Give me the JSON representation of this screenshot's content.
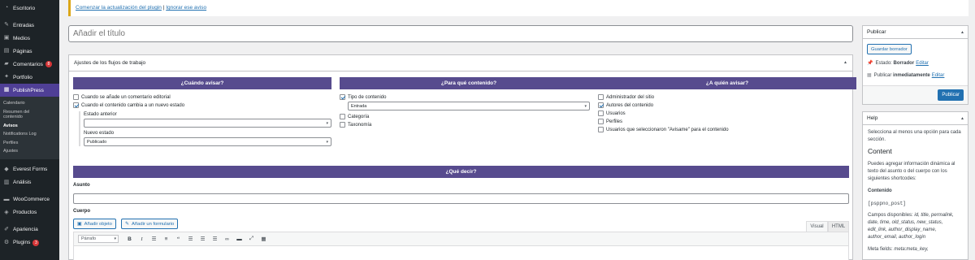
{
  "sidebar": {
    "items": [
      {
        "label": "Escritorio",
        "icon": "dashboard-icon"
      },
      {
        "label": "Entradas",
        "icon": "pin-icon"
      },
      {
        "label": "Medios",
        "icon": "media-icon"
      },
      {
        "label": "Páginas",
        "icon": "page-icon"
      },
      {
        "label": "Comentarios",
        "icon": "comment-icon",
        "badge": "8"
      },
      {
        "label": "Portfolio",
        "icon": "portfolio-icon"
      },
      {
        "label": "PublishPress",
        "icon": "publishpress-icon",
        "active": true
      },
      {
        "label": "Everest Forms",
        "icon": "everest-forms-icon"
      },
      {
        "label": "Análisis",
        "icon": "analytics-icon"
      },
      {
        "label": "WooCommerce",
        "icon": "woocommerce-icon"
      },
      {
        "label": "Productos",
        "icon": "products-icon"
      },
      {
        "label": "Apariencia",
        "icon": "appearance-icon"
      },
      {
        "label": "Plugins",
        "icon": "plugins-icon",
        "badge": "3"
      }
    ],
    "submenu": [
      "Calendario",
      "Resumen del contenido",
      "Avisos",
      "Notifications Log",
      "Perfiles",
      "Ajustes"
    ],
    "submenu_current": "Avisos"
  },
  "notice": {
    "link_update": "Comenzar la actualización del plugin",
    "separator": "|",
    "link_ignore": "Ignorar ese aviso"
  },
  "title": {
    "placeholder": "Añadir el título"
  },
  "workflow": {
    "heading": "Ajustes de los flujos de trabajo",
    "when": {
      "heading": "¿Cuándo avisar?",
      "options": [
        {
          "label": "Cuando se añade un comentario editorial",
          "checked": false
        },
        {
          "label": "Cuando el contenido cambia a un nuevo estado",
          "checked": true
        }
      ],
      "prev_state_label": "Estado anterior",
      "prev_state_value": "",
      "new_state_label": "Nuevo estado",
      "new_state_value": "Publicado"
    },
    "what": {
      "heading": "¿Para qué contenido?",
      "content_type_label": "Tipo de contenido",
      "content_type_value": "Entrada",
      "options": [
        {
          "label": "Categoría",
          "checked": false
        },
        {
          "label": "Taxonomía",
          "checked": false
        }
      ]
    },
    "who": {
      "heading": "¿A quién avisar?",
      "options": [
        {
          "label": "Administrador del sitio",
          "checked": false
        },
        {
          "label": "Autores del contenido",
          "checked": true
        },
        {
          "label": "Usuarios",
          "checked": false
        },
        {
          "label": "Perfiles",
          "checked": false
        },
        {
          "label": "Usuarios que seleccionaron \"Avisame\" para el contenido",
          "checked": false
        }
      ]
    },
    "say": {
      "heading": "¿Qué decir?",
      "subject_label": "Asunto",
      "body_label": "Cuerpo",
      "add_media": "Añadir objeto",
      "add_form": "Añadir un formulario",
      "tab_visual": "Visual",
      "tab_html": "HTML",
      "format_select": "Párrafo"
    }
  },
  "publish": {
    "heading": "Publicar",
    "save_draft": "Guardar borrador",
    "status_label": "Estado:",
    "status_value": "Borrador",
    "edit": "Editar",
    "publish_label": "Publicar",
    "publish_value": "inmediatamente",
    "publish_button": "Publicar"
  },
  "help": {
    "heading": "Help",
    "intro": "Selecciona al menos una opción para cada sección.",
    "content_title": "Content",
    "content_desc": "Puedes agregar información dinámica al texto del asunto o del cuerpo con los siguientes shortcodes:",
    "subheading": "Contenido",
    "shortcode": "[psppno_post]",
    "fields_label": "Campos disponibles:",
    "fields": "id, title, permalink, date, time, old_status, new_status, edit_link, author_display_name, author_email, author_login",
    "meta_label": "Meta fields:",
    "meta": "meta:meta_key,"
  }
}
